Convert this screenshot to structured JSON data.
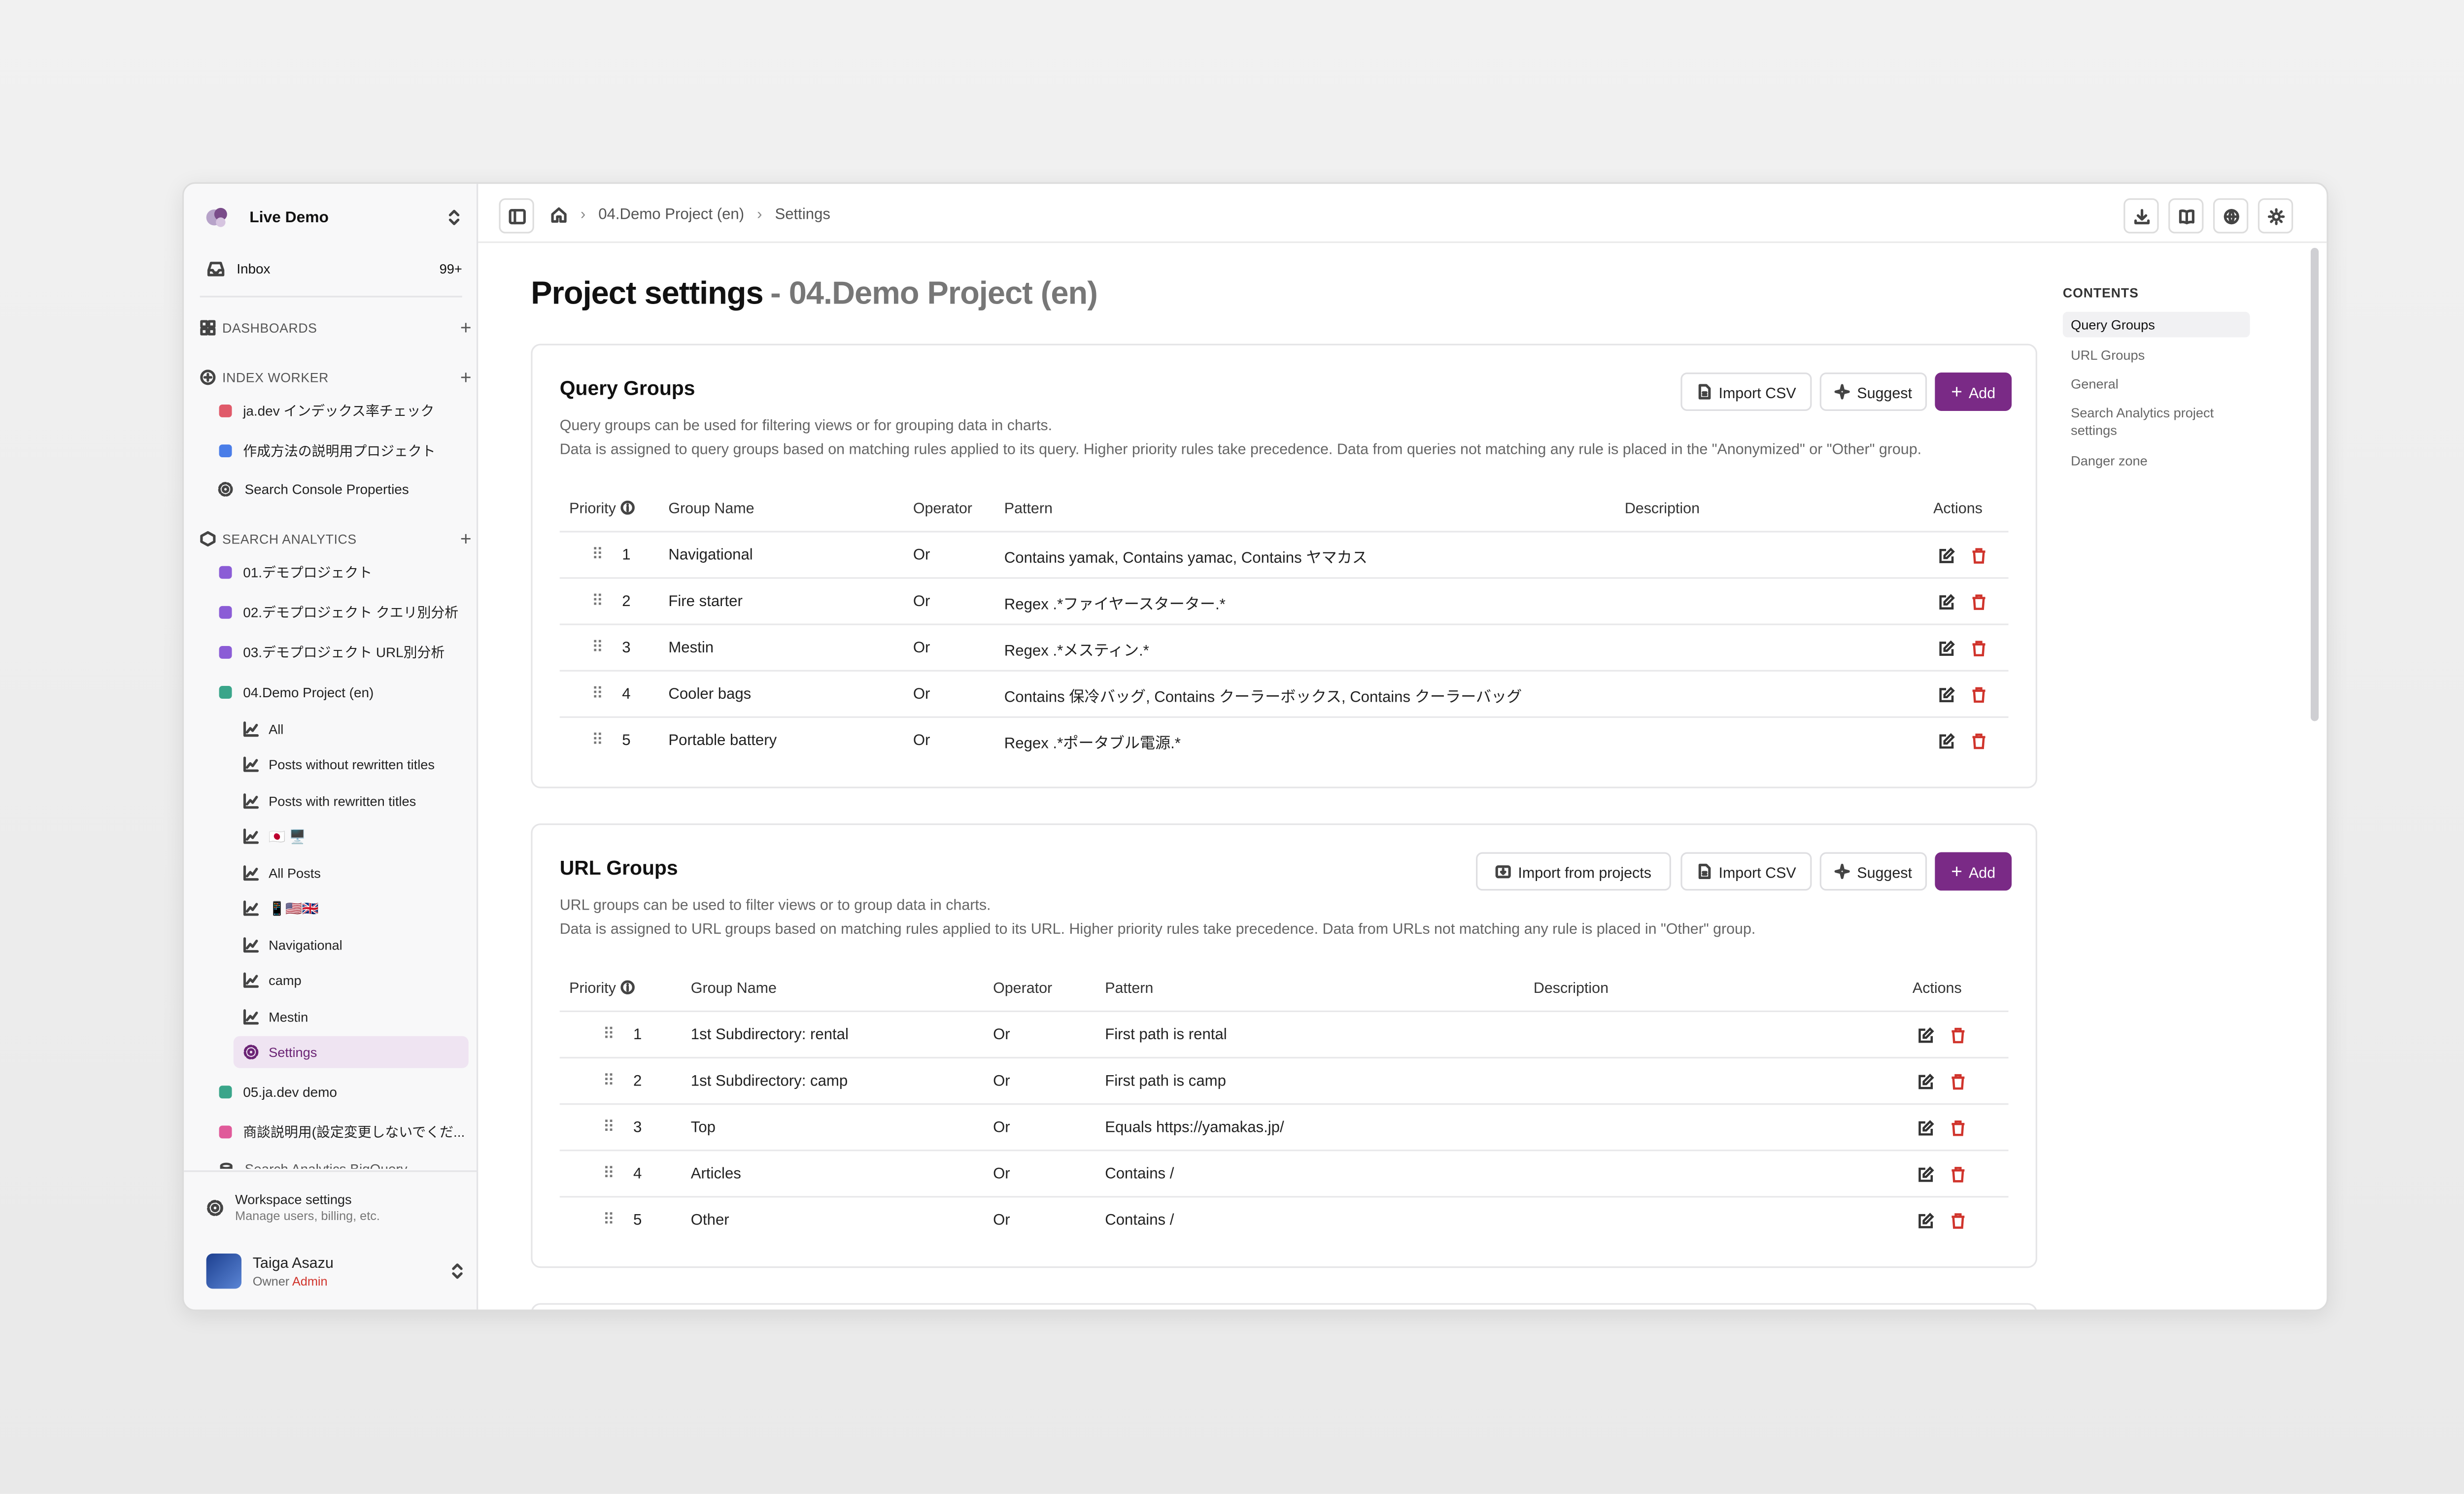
{
  "workspace": {
    "name": "Live Demo"
  },
  "inbox": {
    "label": "Inbox",
    "count": "99+"
  },
  "sections": {
    "dashboards": "DASHBOARDS",
    "index_worker": "INDEX WORKER",
    "search_analytics": "SEARCH ANALYTICS"
  },
  "index_worker_items": [
    {
      "label": "ja.dev インデックス率チェック",
      "color": "#e05a6a"
    },
    {
      "label": "作成方法の説明用プロジェクト",
      "color": "#4a7de8"
    },
    {
      "label": "Search Console Properties",
      "icon": "gear-icon"
    }
  ],
  "search_analytics_items": [
    {
      "label": "01.デモプロジェクト",
      "color": "#8b5cd6"
    },
    {
      "label": "02.デモプロジェクト クエリ別分析",
      "color": "#8b5cd6"
    },
    {
      "label": "03.デモプロジェクト URL別分析",
      "color": "#8b5cd6"
    },
    {
      "label": "04.Demo Project (en)",
      "color": "#3aa58a"
    }
  ],
  "project_subitems": [
    {
      "label": "All"
    },
    {
      "label": "Posts without rewritten titles"
    },
    {
      "label": "Posts with rewritten titles"
    },
    {
      "label": "🇯🇵 🖥️"
    },
    {
      "label": "All Posts"
    },
    {
      "label": "📱🇺🇸🇬🇧"
    },
    {
      "label": "Navigational"
    },
    {
      "label": "camp"
    },
    {
      "label": "Mestin"
    },
    {
      "label": "Settings",
      "active": true
    }
  ],
  "more_projects": [
    {
      "label": "05.ja.dev demo",
      "color": "#3aa58a"
    },
    {
      "label": "商談説明用(設定変更しないでくだ...",
      "color": "#e05a9a"
    },
    {
      "label": "Search Analytics BigQuery",
      "color": "#777"
    }
  ],
  "workspace_settings": {
    "title": "Workspace settings",
    "subtitle": "Manage users, billing, etc."
  },
  "user": {
    "name": "Taiga Asazu",
    "role": "Owner",
    "badge": "Admin"
  },
  "breadcrumb": {
    "project": "04.Demo Project (en)",
    "page": "Settings"
  },
  "page": {
    "title": "Project settings",
    "subtitle": "- 04.Demo Project (en)"
  },
  "query_groups": {
    "title": "Query Groups",
    "desc1": "Query groups can be used for filtering views or for grouping data in charts.",
    "desc2": "Data is assigned to query groups based on matching rules applied to its query. Higher priority rules take precedence. Data from queries not matching any rule is placed in the \"Anonymized\" or \"Other\" group.",
    "buttons": {
      "import_csv": "Import CSV",
      "suggest": "Suggest",
      "add": "Add"
    },
    "columns": {
      "priority": "Priority",
      "group_name": "Group Name",
      "operator": "Operator",
      "pattern": "Pattern",
      "description": "Description",
      "actions": "Actions"
    },
    "rows": [
      {
        "priority": "1",
        "name": "Navigational",
        "operator": "Or",
        "pattern": "Contains yamak, Contains yamac, Contains ヤマカス"
      },
      {
        "priority": "2",
        "name": "Fire starter",
        "operator": "Or",
        "pattern": "Regex .*ファイヤースターター.*"
      },
      {
        "priority": "3",
        "name": "Mestin",
        "operator": "Or",
        "pattern": "Regex .*メスティン.*"
      },
      {
        "priority": "4",
        "name": "Cooler bags",
        "operator": "Or",
        "pattern": "Contains 保冷バッグ, Contains クーラーボックス, Contains クーラーバッグ"
      },
      {
        "priority": "5",
        "name": "Portable battery",
        "operator": "Or",
        "pattern": "Regex .*ポータブル電源.*"
      }
    ]
  },
  "url_groups": {
    "title": "URL Groups",
    "desc1": "URL groups can be used to filter views or to group data in charts.",
    "desc2": "Data is assigned to URL groups based on matching rules applied to its URL. Higher priority rules take precedence. Data from URLs not matching any rule is placed in \"Other\" group.",
    "buttons": {
      "import_projects": "Import from projects",
      "import_csv": "Import CSV",
      "suggest": "Suggest",
      "add": "Add"
    },
    "columns": {
      "priority": "Priority",
      "group_name": "Group Name",
      "operator": "Operator",
      "pattern": "Pattern",
      "description": "Description",
      "actions": "Actions"
    },
    "rows": [
      {
        "priority": "1",
        "name": "1st Subdirectory: rental",
        "operator": "Or",
        "pattern": "First path is rental"
      },
      {
        "priority": "2",
        "name": "1st Subdirectory: camp",
        "operator": "Or",
        "pattern": "First path is camp"
      },
      {
        "priority": "3",
        "name": "Top",
        "operator": "Or",
        "pattern": "Equals https://yamakas.jp/"
      },
      {
        "priority": "4",
        "name": "Articles",
        "operator": "Or",
        "pattern": "Contains /"
      },
      {
        "priority": "5",
        "name": "Other",
        "operator": "Or",
        "pattern": "Contains /"
      }
    ]
  },
  "toc": {
    "heading": "CONTENTS",
    "items": [
      {
        "label": "Query Groups",
        "active": true
      },
      {
        "label": "URL Groups"
      },
      {
        "label": "General"
      },
      {
        "label": "Search Analytics project settings"
      },
      {
        "label": "Danger zone"
      }
    ]
  },
  "colors": {
    "accent": "#7a2a86",
    "danger": "#d0342c",
    "active_bg": "#efe4f2"
  }
}
